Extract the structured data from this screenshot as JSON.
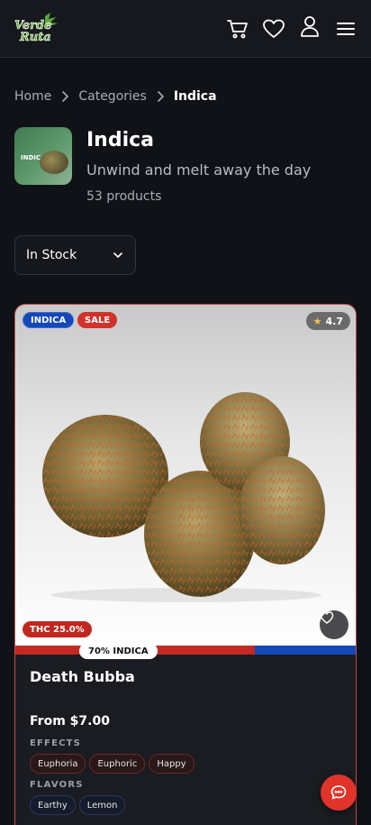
{
  "header": {
    "logo_text": "Verde Ruta",
    "icons": [
      "cart-icon",
      "heart-icon",
      "user-icon",
      "menu-icon"
    ]
  },
  "breadcrumb": {
    "items": [
      "Home",
      "Categories",
      "Indica"
    ]
  },
  "category": {
    "thumb_label": "INDICA",
    "title": "Indica",
    "tagline": "Unwind and melt away the day",
    "count": "53 products"
  },
  "filter": {
    "selected": "In Stock"
  },
  "product": {
    "badge_type": "INDICA",
    "badge_sale": "SALE",
    "rating": "4.7",
    "thc": "THC 25.0%",
    "strain_label": "70% INDICA",
    "strain_indica_fraction": 0.7,
    "name": "Death Bubba",
    "price": "From $7.00",
    "effects_label": "EFFECTS",
    "effects": [
      "Euphoria",
      "Euphoric",
      "Happy"
    ],
    "flavors_label": "FLAVORS",
    "flavors": [
      "Earthy",
      "Lemon"
    ]
  },
  "colors": {
    "accent": "#e0342b",
    "indica_blue": "#1447b8",
    "sale_red": "#d1322a",
    "background": "#101217"
  }
}
